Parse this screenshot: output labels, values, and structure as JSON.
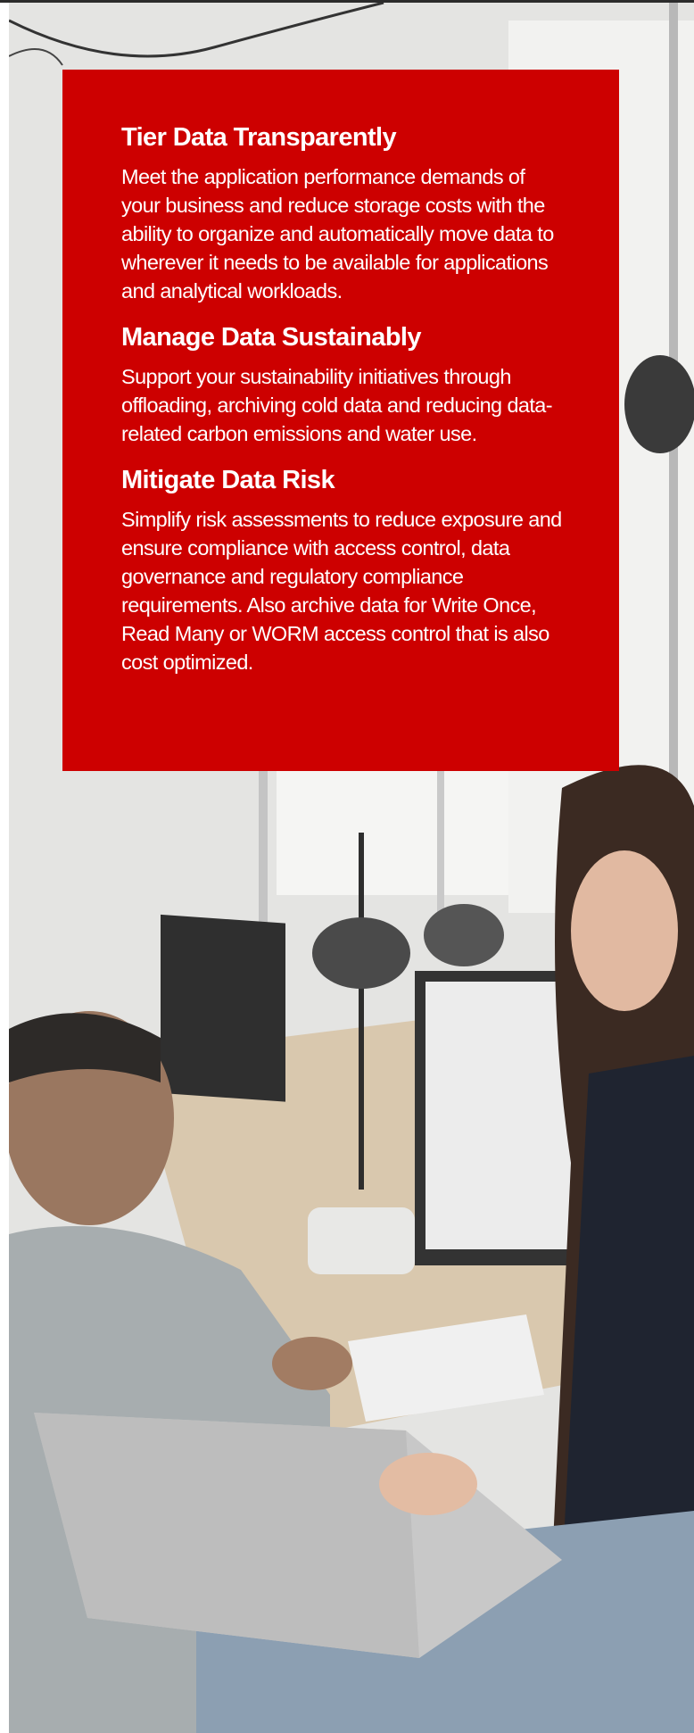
{
  "sections": [
    {
      "heading": "Tier Data Transparently",
      "body": "Meet the application performance demands of your business and reduce storage costs with the ability to organize and automatically move data to wherever it needs to be available for applications and analytical workloads."
    },
    {
      "heading": "Manage Data Sustainably",
      "body": "Support your sustainability initiatives through offloading, archiving cold data and reducing data-related carbon emissions and water use."
    },
    {
      "heading": "Mitigate Data Risk",
      "body": "Simplify risk assessments to reduce exposure and ensure compliance with access control, data governance and regulatory compliance requirements. Also archive data for Write Once, Read Many or WORM access control that is also cost optimized."
    }
  ],
  "colors": {
    "card_background": "#cd0000",
    "card_text": "#ffffff"
  }
}
